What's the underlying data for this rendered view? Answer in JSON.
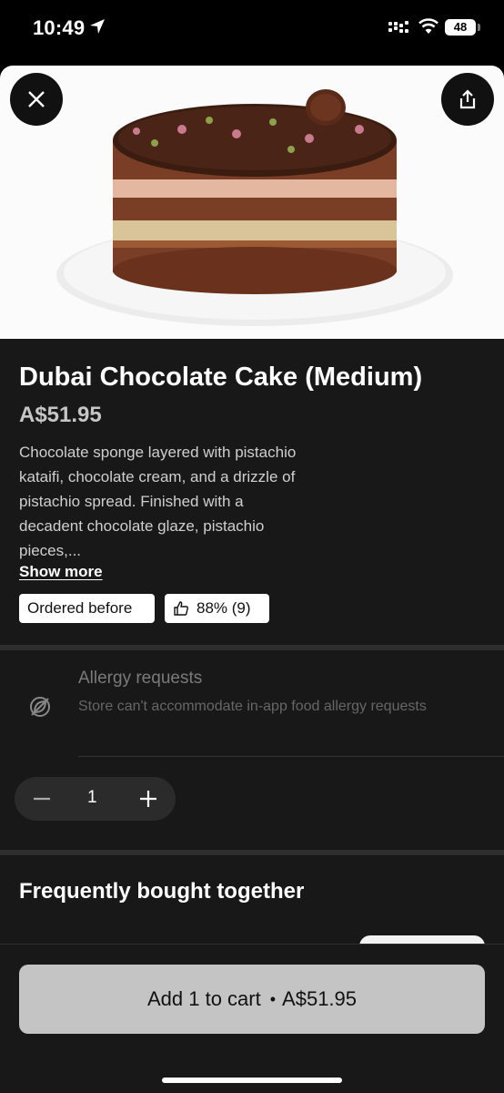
{
  "status_bar": {
    "time": "10:49",
    "battery": "48"
  },
  "header": {
    "close_icon": "close-icon",
    "share_icon": "share-icon"
  },
  "product": {
    "title": "Dubai Chocolate Cake (Medium)",
    "price": "A$51.95",
    "description": "Chocolate sponge layered with pistachio kataifi, chocolate cream, and a drizzle of pistachio spread. Finished with a decadent chocolate glaze, pistachio pieces,...",
    "show_more": "Show more",
    "badges": {
      "ordered_before": "Ordered before",
      "rating": "88% (9)"
    }
  },
  "allergy": {
    "title": "Allergy requests",
    "text": "Store can't accommodate in-app food allergy requests"
  },
  "quantity": {
    "value": "1"
  },
  "section": {
    "frequently_bought": "Frequently bought together"
  },
  "cart": {
    "label": "Add 1 to cart",
    "separator": "•",
    "price": "A$51.95"
  },
  "colors": {
    "background": "#181818",
    "button": "#c4c4c4",
    "chip": "#ffffff"
  }
}
